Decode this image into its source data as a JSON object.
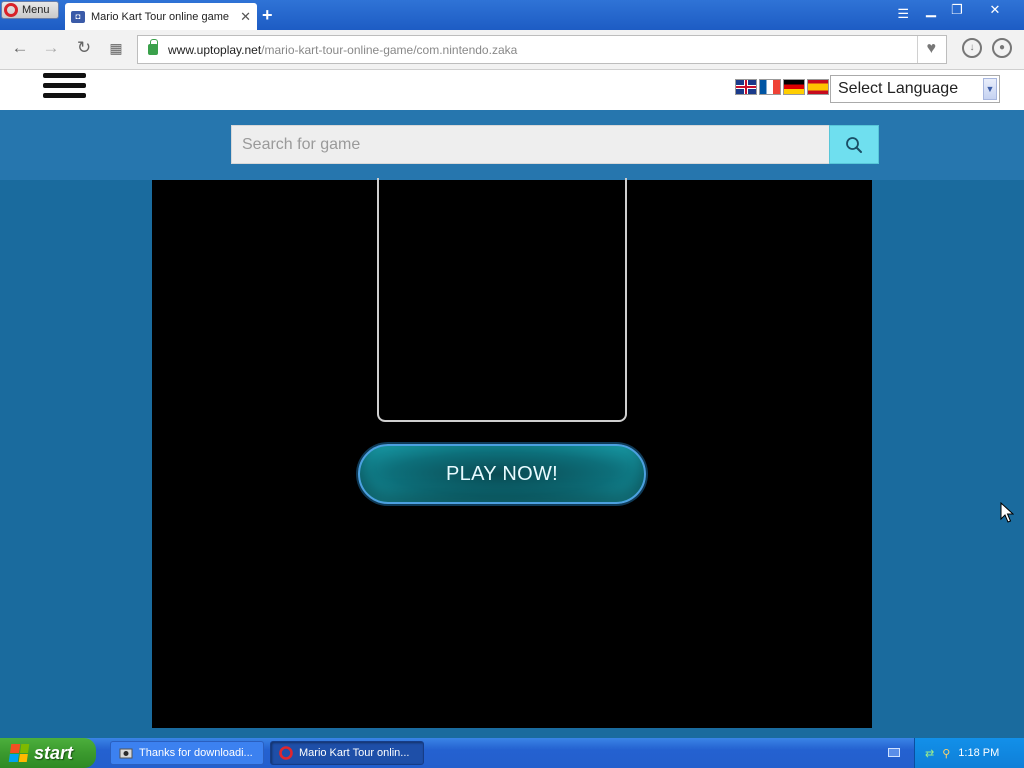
{
  "browser": {
    "menu_label": "Menu",
    "tab_title": "Mario Kart Tour online game",
    "tab_close": "✕",
    "new_tab": "+",
    "url_domain": "www.uptoplay.net",
    "url_path": "/mario-kart-tour-online-game/com.nintendo.zaka"
  },
  "header": {
    "language_select": "Select Language",
    "flags": [
      "uk-flag-icon",
      "france-flag-icon",
      "germany-flag-icon",
      "spain-flag-icon"
    ]
  },
  "search": {
    "placeholder": "Search for game"
  },
  "game": {
    "play_button": "PLAY NOW!"
  },
  "taskbar": {
    "start_label": "start",
    "tasks": [
      {
        "label": "Thanks for downloadi..."
      },
      {
        "label": "Mario Kart Tour onlin..."
      }
    ],
    "clock": "1:18 PM"
  },
  "colors": {
    "page_bg": "#1a6b9e",
    "search_band": "#2676ae",
    "search_button": "#6fdfef",
    "play_button_teal": "#0d6f7a"
  }
}
